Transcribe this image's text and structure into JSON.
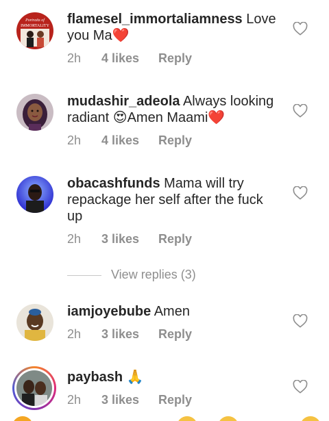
{
  "comments": [
    {
      "username": "flamesel_immortaliamness",
      "text": " Love you Ma",
      "emoji": "❤️",
      "time": "2h",
      "likes": "4 likes",
      "reply": "Reply",
      "avatar_text": "Portraits of IMMORTALITY"
    },
    {
      "username": "mudashir_adeola",
      "text": " Always looking radiant ",
      "emoji_face": "😍",
      "text2": "Amen Maami",
      "emoji": "❤️",
      "time": "2h",
      "likes": "4 likes",
      "reply": "Reply"
    },
    {
      "username": "obacashfunds",
      "text": " Mama will try repackage her self after the fuck up",
      "time": "2h",
      "likes": "3 likes",
      "reply": "Reply"
    },
    {
      "username": "iamjoyebube",
      "text": " Amen",
      "time": "2h",
      "likes": "3 likes",
      "reply": "Reply"
    },
    {
      "username": "paybash",
      "text": " ",
      "emoji": "🙏",
      "time": "2h",
      "likes": "3 likes",
      "reply": "Reply"
    }
  ],
  "view_replies": "View replies (3)",
  "colors": {
    "text": "#262626",
    "secondary": "#8e8e8e",
    "heart_emoji": "#e0245e"
  },
  "icons": [
    "heart-outline-icon"
  ]
}
